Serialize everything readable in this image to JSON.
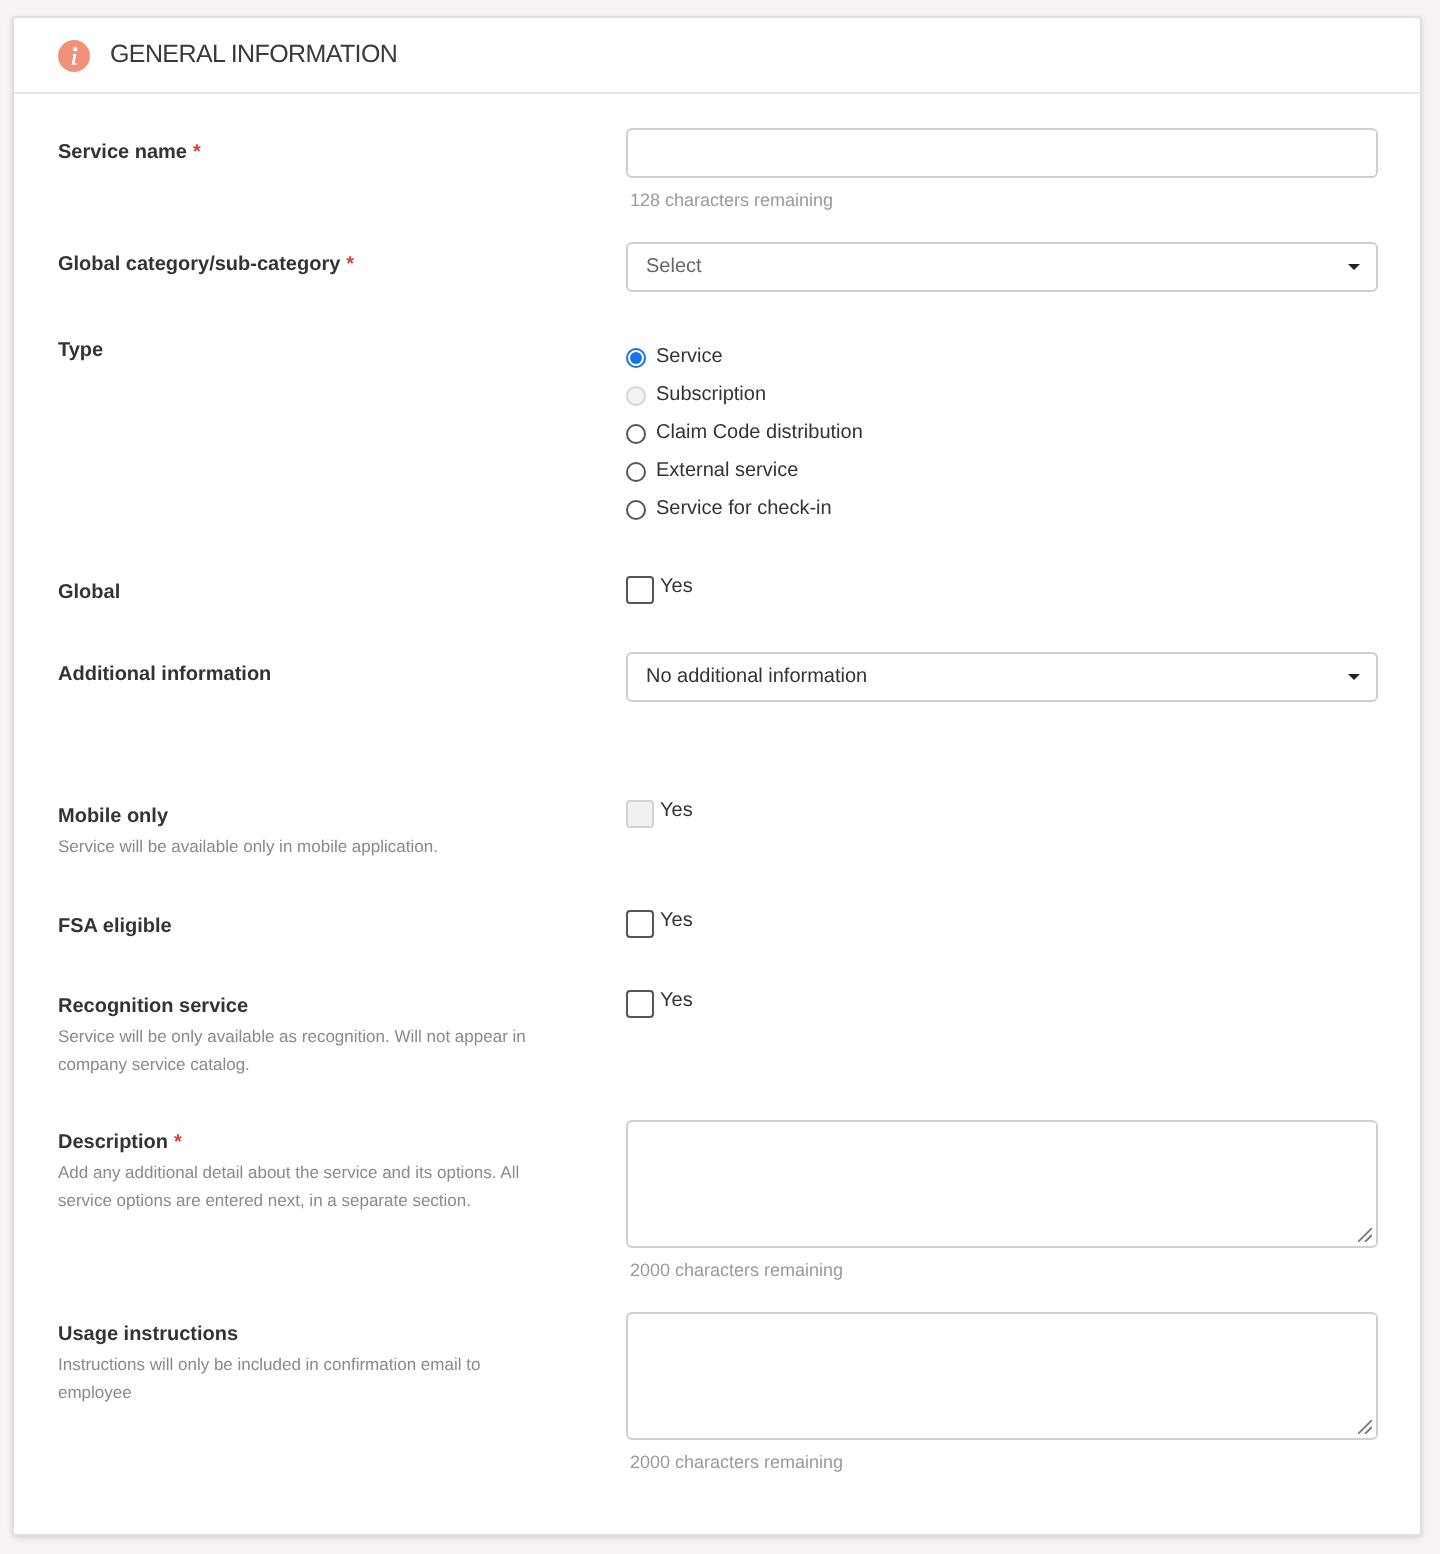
{
  "section": {
    "title": "GENERAL INFORMATION"
  },
  "fields": [
    {
      "kind": "text",
      "label": "Service name",
      "required_mark": "*",
      "hint": "128 characters remaining"
    },
    {
      "kind": "select",
      "label": "Global category/sub-category",
      "required_mark": "*",
      "placeholder": "Select"
    },
    {
      "kind": "radio",
      "label": "Type",
      "options": [
        {
          "label": "Service",
          "selected": true,
          "disabled": false
        },
        {
          "label": "Subscription",
          "selected": false,
          "disabled": true
        },
        {
          "label": "Claim Code distribution",
          "selected": false,
          "disabled": false
        },
        {
          "label": "External service",
          "selected": false,
          "disabled": false
        },
        {
          "label": "Service for check-in",
          "selected": false,
          "disabled": false
        }
      ]
    },
    {
      "kind": "checkbox",
      "label": "Global",
      "option": "Yes",
      "checked": false,
      "disabled": false
    },
    {
      "kind": "select",
      "label": "Additional information",
      "value": "No additional information"
    },
    {
      "kind": "checkbox",
      "label": "Mobile only",
      "description": "Service will be available only in mobile application.",
      "option": "Yes",
      "checked": false,
      "disabled": true
    },
    {
      "kind": "checkbox",
      "label": "FSA eligible",
      "option": "Yes",
      "checked": false,
      "disabled": false
    },
    {
      "kind": "checkbox",
      "label": "Recognition service",
      "description": "Service will be only available as recognition. Will not appear in company service catalog.",
      "option": "Yes",
      "checked": false,
      "disabled": false
    },
    {
      "kind": "textarea",
      "label": "Description",
      "required_mark": "*",
      "description": "Add any additional detail about the service and its options. All service options are entered next, in a separate section.",
      "hint": "2000 characters remaining"
    },
    {
      "kind": "textarea",
      "label": "Usage instructions",
      "description": "Instructions will only be included in confirmation email to employee",
      "hint": "2000 characters remaining"
    }
  ]
}
